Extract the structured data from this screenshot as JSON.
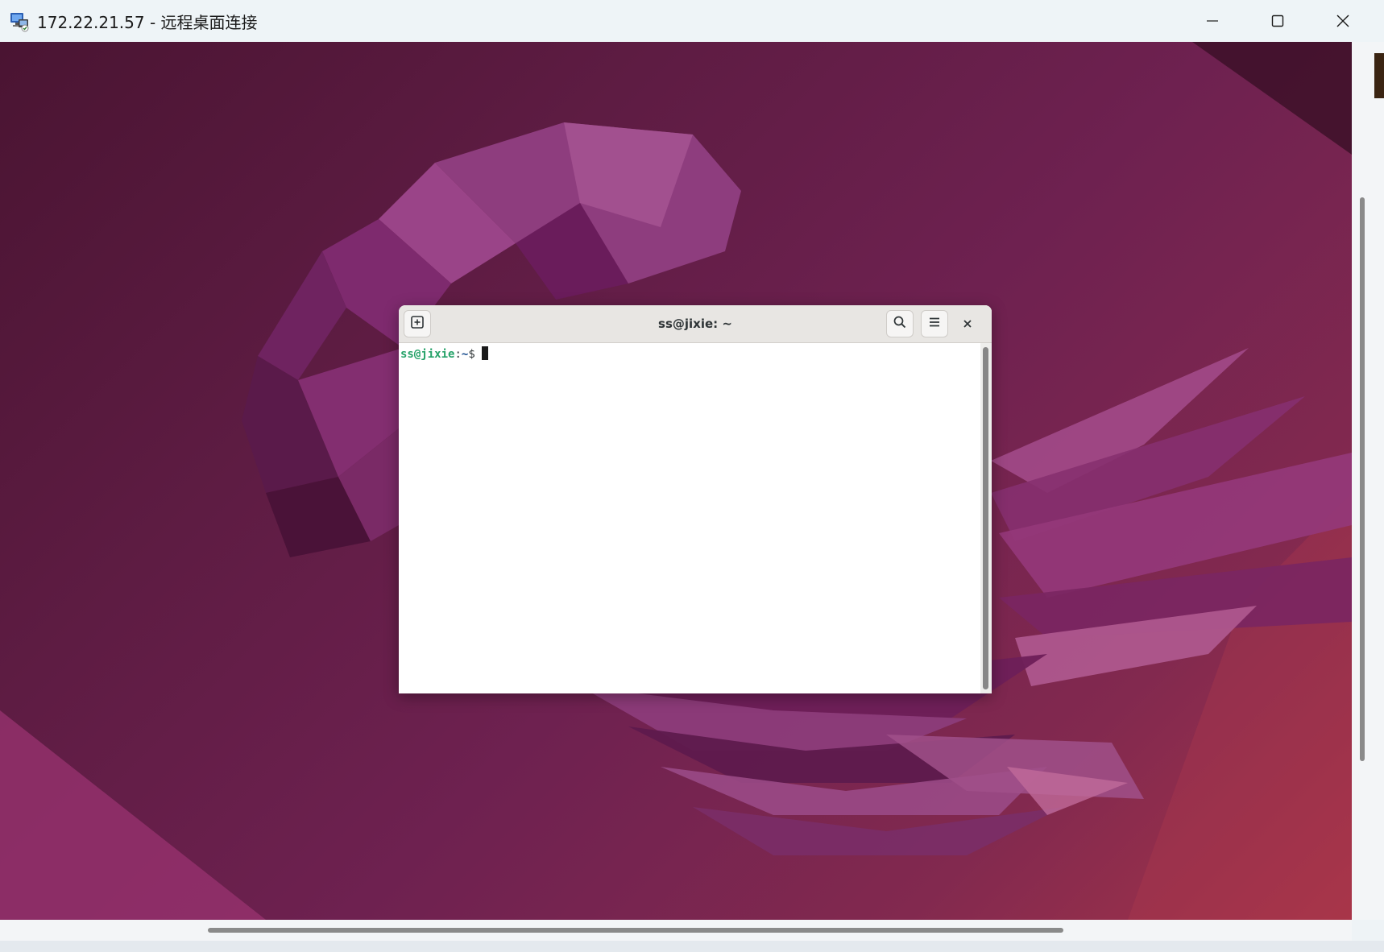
{
  "window": {
    "title": "172.22.21.57 - 远程桌面连接",
    "icon": "remote-desktop-icon",
    "controls": {
      "minimize": "minimize-icon",
      "maximize": "maximize-icon",
      "close": "close-icon"
    }
  },
  "terminal": {
    "title": "ss@jixie: ~",
    "icons": {
      "new_tab": "new-tab-icon",
      "search": "search-icon",
      "menu": "hamburger-menu-icon",
      "close": "close-icon"
    },
    "prompt": {
      "user_host": "ss@jixie",
      "separator": ":",
      "path": "~",
      "symbol": "$"
    }
  },
  "colors": {
    "prompt_user": "#26a269",
    "prompt_path": "#12488b",
    "wallpaper_base": "#6e2150"
  }
}
